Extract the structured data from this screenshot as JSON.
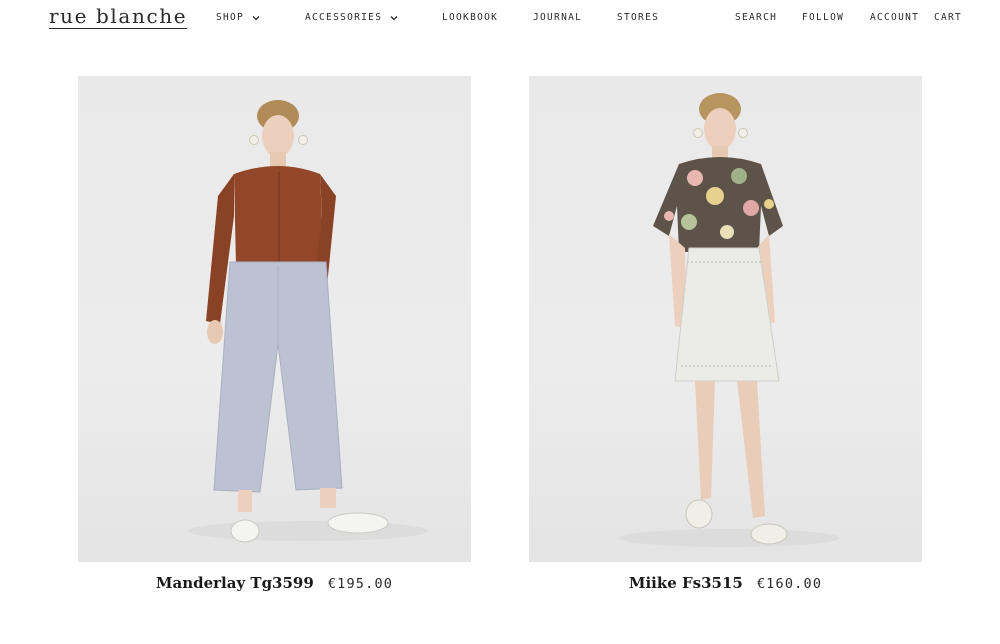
{
  "header": {
    "logo": "rue blanche",
    "nav": {
      "shop": "SHOP",
      "accessories": "ACCESSORIES",
      "lookbook": "LOOKBOOK",
      "journal": "JOURNAL",
      "stores": "STORES",
      "search": "SEARCH",
      "follow": "FOLLOW",
      "account": "ACCOUNT",
      "cart": "CART"
    },
    "dropdown_icon": "chevron-down-icon"
  },
  "products": [
    {
      "name": "Manderlay Tg3599",
      "price": "€195.00"
    },
    {
      "name": "Miike Fs3515",
      "price": "€160.00"
    }
  ],
  "colors": {
    "background": "#ffffff",
    "text": "#1a1a1a",
    "photo_background": "#ebebeb"
  }
}
